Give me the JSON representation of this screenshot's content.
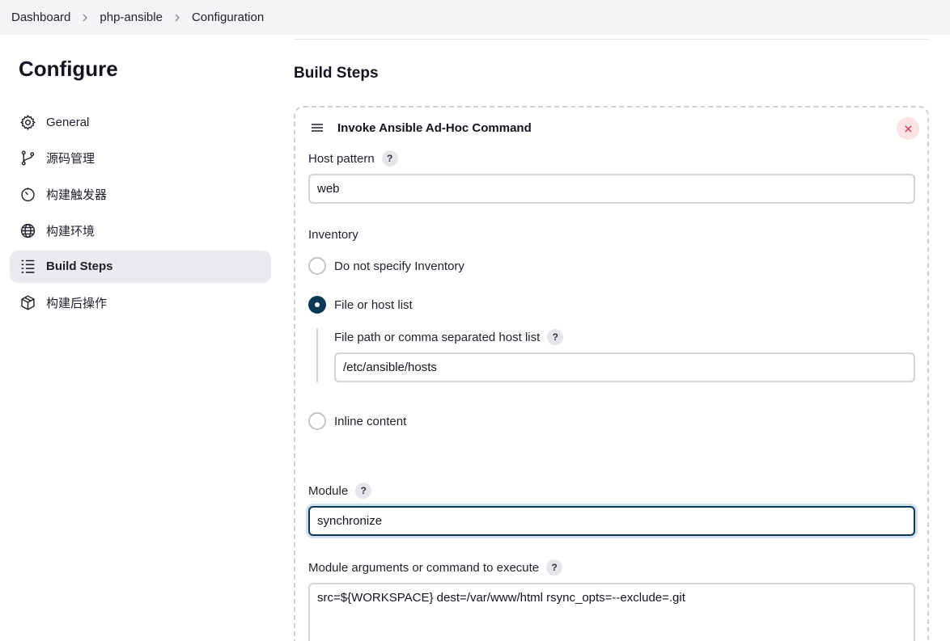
{
  "breadcrumb": [
    "Dashboard",
    "php-ansible",
    "Configuration"
  ],
  "sidebar": {
    "title": "Configure",
    "items": [
      {
        "label": "General",
        "icon": "gear-icon",
        "active": false
      },
      {
        "label": "源码管理",
        "icon": "branch-icon",
        "active": false
      },
      {
        "label": "构建触发器",
        "icon": "timer-icon",
        "active": false
      },
      {
        "label": "构建环境",
        "icon": "globe-icon",
        "active": false
      },
      {
        "label": "Build Steps",
        "icon": "list-icon",
        "active": true
      },
      {
        "label": "构建后操作",
        "icon": "package-icon",
        "active": false
      }
    ]
  },
  "main": {
    "section_title": "Build Steps",
    "step": {
      "title": "Invoke Ansible Ad-Hoc Command",
      "host_pattern": {
        "label": "Host pattern",
        "value": "web"
      },
      "inventory": {
        "label": "Inventory",
        "options": [
          {
            "label": "Do not specify Inventory",
            "checked": false
          },
          {
            "label": "File or host list",
            "checked": true
          },
          {
            "label": "Inline content",
            "checked": false
          }
        ],
        "file_path": {
          "label": "File path or comma separated host list",
          "value": "/etc/ansible/hosts"
        }
      },
      "module": {
        "label": "Module",
        "value": "synchronize"
      },
      "module_args": {
        "label": "Module arguments or command to execute",
        "value": "src=${WORKSPACE} dest=/var/www/html rsync_opts=--exclude=.git"
      }
    },
    "help_glyph": "?"
  },
  "colors": {
    "accent": "#0b3a59",
    "active_bg": "#ebebef",
    "close_bg": "#fbe3e5",
    "close_fg": "#d13b4c"
  }
}
